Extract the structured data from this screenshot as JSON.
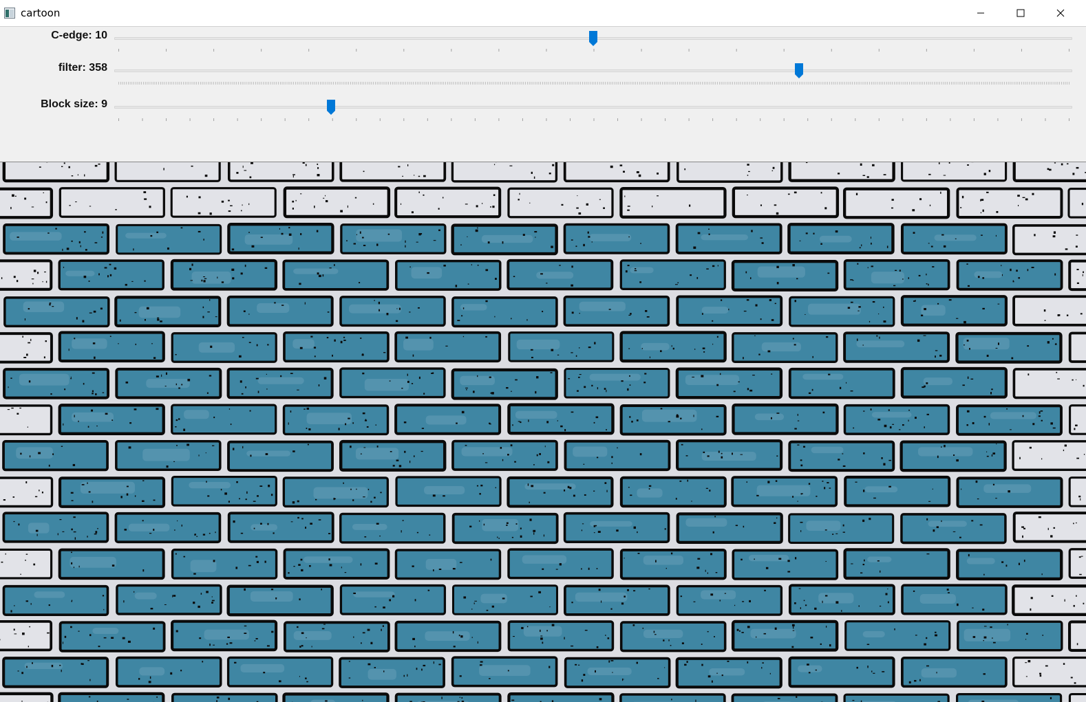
{
  "window": {
    "title": "cartoon"
  },
  "trackbars": [
    {
      "label": "C-edge: 10",
      "value": 10,
      "max": 20
    },
    {
      "label": "filter: 358",
      "value": 358,
      "max": 500
    },
    {
      "label": "Block size: 9",
      "value": 9,
      "max": 40
    }
  ],
  "colors": {
    "accent": "#0078d7",
    "brick": "#3f86a3",
    "mortar": "#dcdde2",
    "edge": "#0a0a0a"
  },
  "icons": {
    "minimize": "minimize-icon",
    "maximize": "maximize-icon",
    "close": "close-icon",
    "app": "app-icon"
  }
}
